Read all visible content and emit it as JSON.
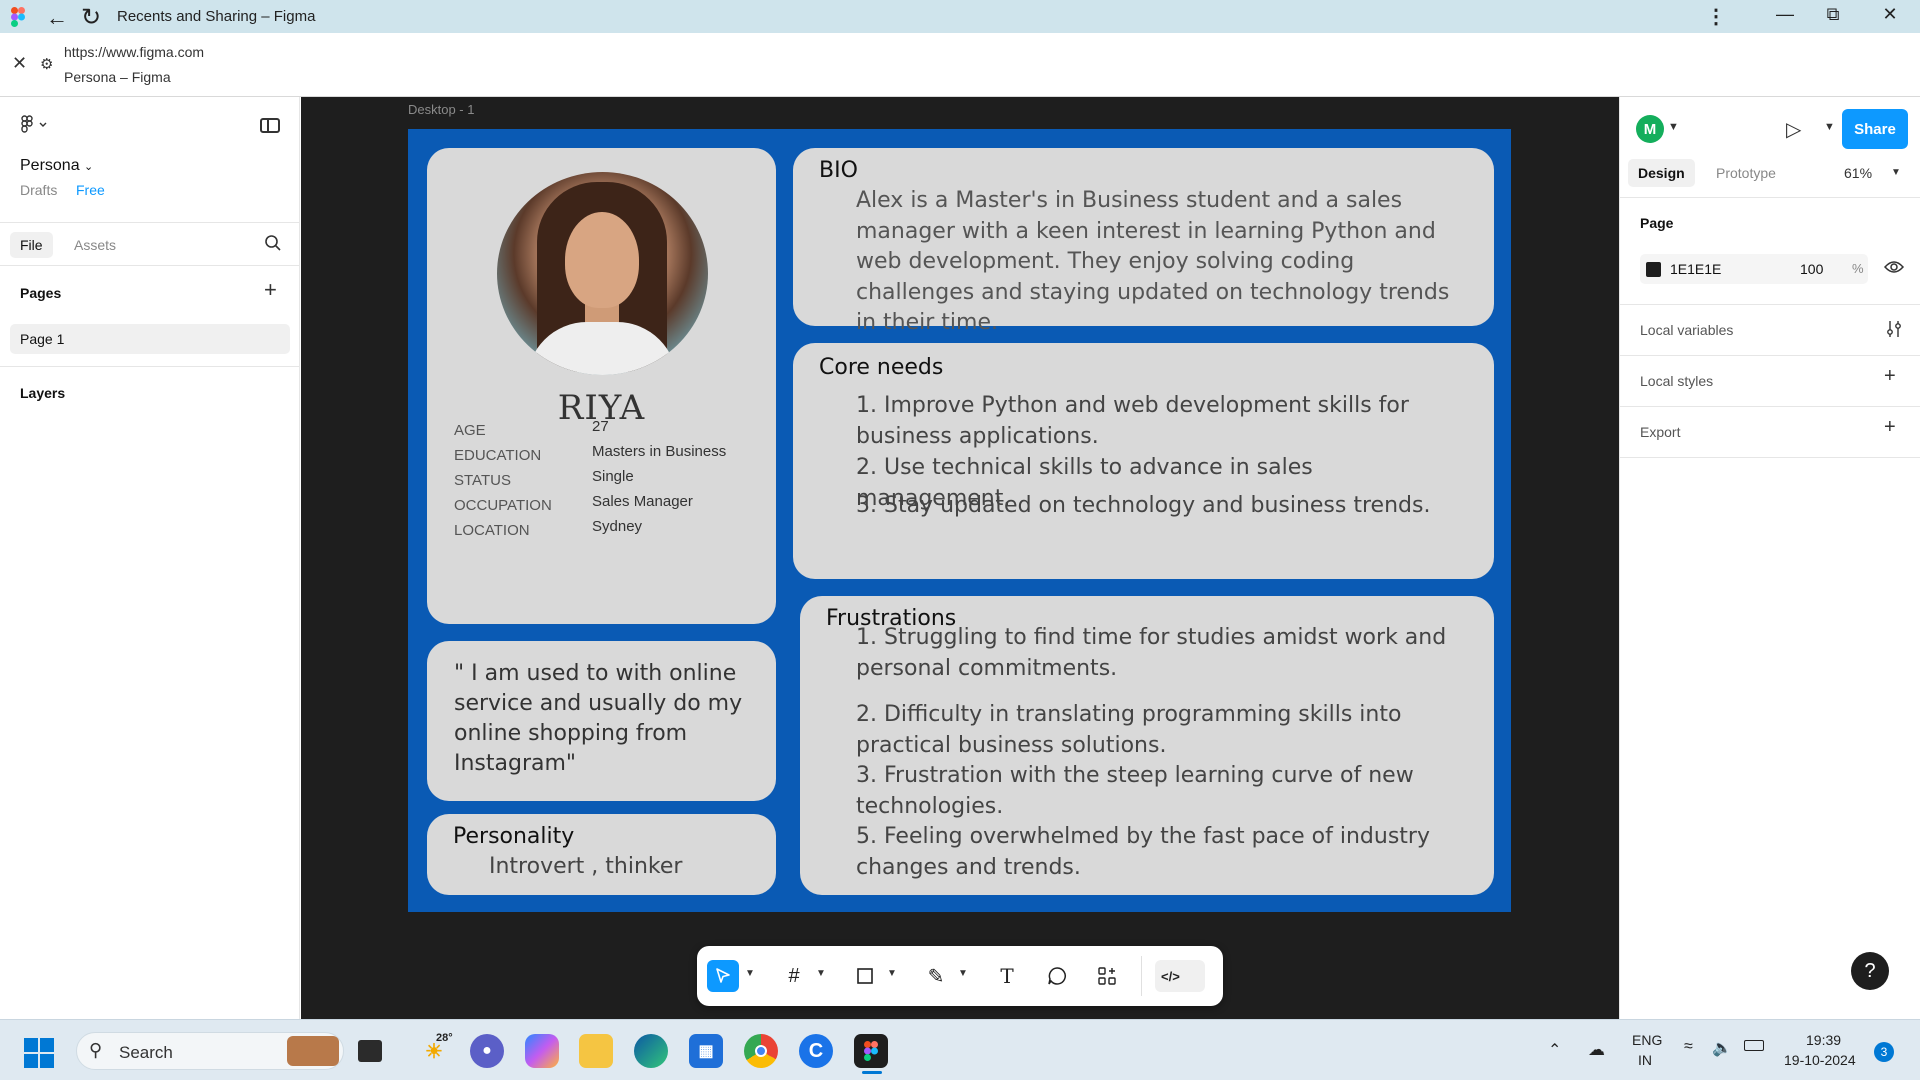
{
  "browser": {
    "window_title": "Recents and Sharing – Figma",
    "url": "https://www.figma.com",
    "page_title": "Persona – Figma"
  },
  "left_panel": {
    "project_name": "Persona",
    "drafts_label": "Drafts",
    "plan_label": "Free",
    "tabs": {
      "file": "File",
      "assets": "Assets"
    },
    "pages_label": "Pages",
    "pages": [
      "Page 1"
    ],
    "layers_label": "Layers"
  },
  "canvas": {
    "frame_label": "Desktop - 1",
    "profile": {
      "name": "RIYA",
      "attributes": [
        {
          "label": "AGE",
          "value": "27"
        },
        {
          "label": "EDUCATION",
          "value": "Masters in Business"
        },
        {
          "label": "STATUS",
          "value": "Single"
        },
        {
          "label": "OCCUPATION",
          "value": "Sales Manager"
        },
        {
          "label": "LOCATION",
          "value": "Sydney"
        }
      ]
    },
    "quote": "\" I am used to with online service and usually do my online shopping from Instagram\"",
    "personality": {
      "title": "Personality",
      "text": "Introvert , thinker"
    },
    "bio": {
      "title": "BIO",
      "text": "Alex is a Master's in Business student and a sales manager with a keen interest in learning Python and web development. They enjoy solving coding challenges and staying updated on technology trends in their time."
    },
    "core_needs": {
      "title": "Core needs",
      "items": [
        "1. Improve Python and web development skills for business applications.",
        "2. Use technical skills to advance in sales management.",
        "3. Stay updated on technology and business trends."
      ]
    },
    "frustrations": {
      "title": "Frustrations",
      "items": [
        "1. Struggling to find time for studies amidst work and personal commitments.",
        "2. Difficulty in translating programming skills into practical business solutions.",
        "3. Frustration with the steep learning curve of new technologies.",
        "5. Feeling overwhelmed by the fast pace of industry changes and trends."
      ]
    },
    "frame_color": "#0A5AB4",
    "card_color": "#D9D9D9"
  },
  "right_panel": {
    "avatar_initial": "M",
    "share_label": "Share",
    "tabs": {
      "design": "Design",
      "prototype": "Prototype"
    },
    "zoom": "61%",
    "page_label": "Page",
    "page_color": "1E1E1E",
    "page_opacity": "100",
    "opacity_unit": "%",
    "rows": [
      "Local variables",
      "Local styles",
      "Export"
    ],
    "help": "?"
  },
  "taskbar": {
    "search_placeholder": "Search",
    "weather_temp": "28°",
    "language_top": "ENG",
    "language_bottom": "IN",
    "time": "19:39",
    "date": "19-10-2024",
    "notification_count": "3"
  }
}
